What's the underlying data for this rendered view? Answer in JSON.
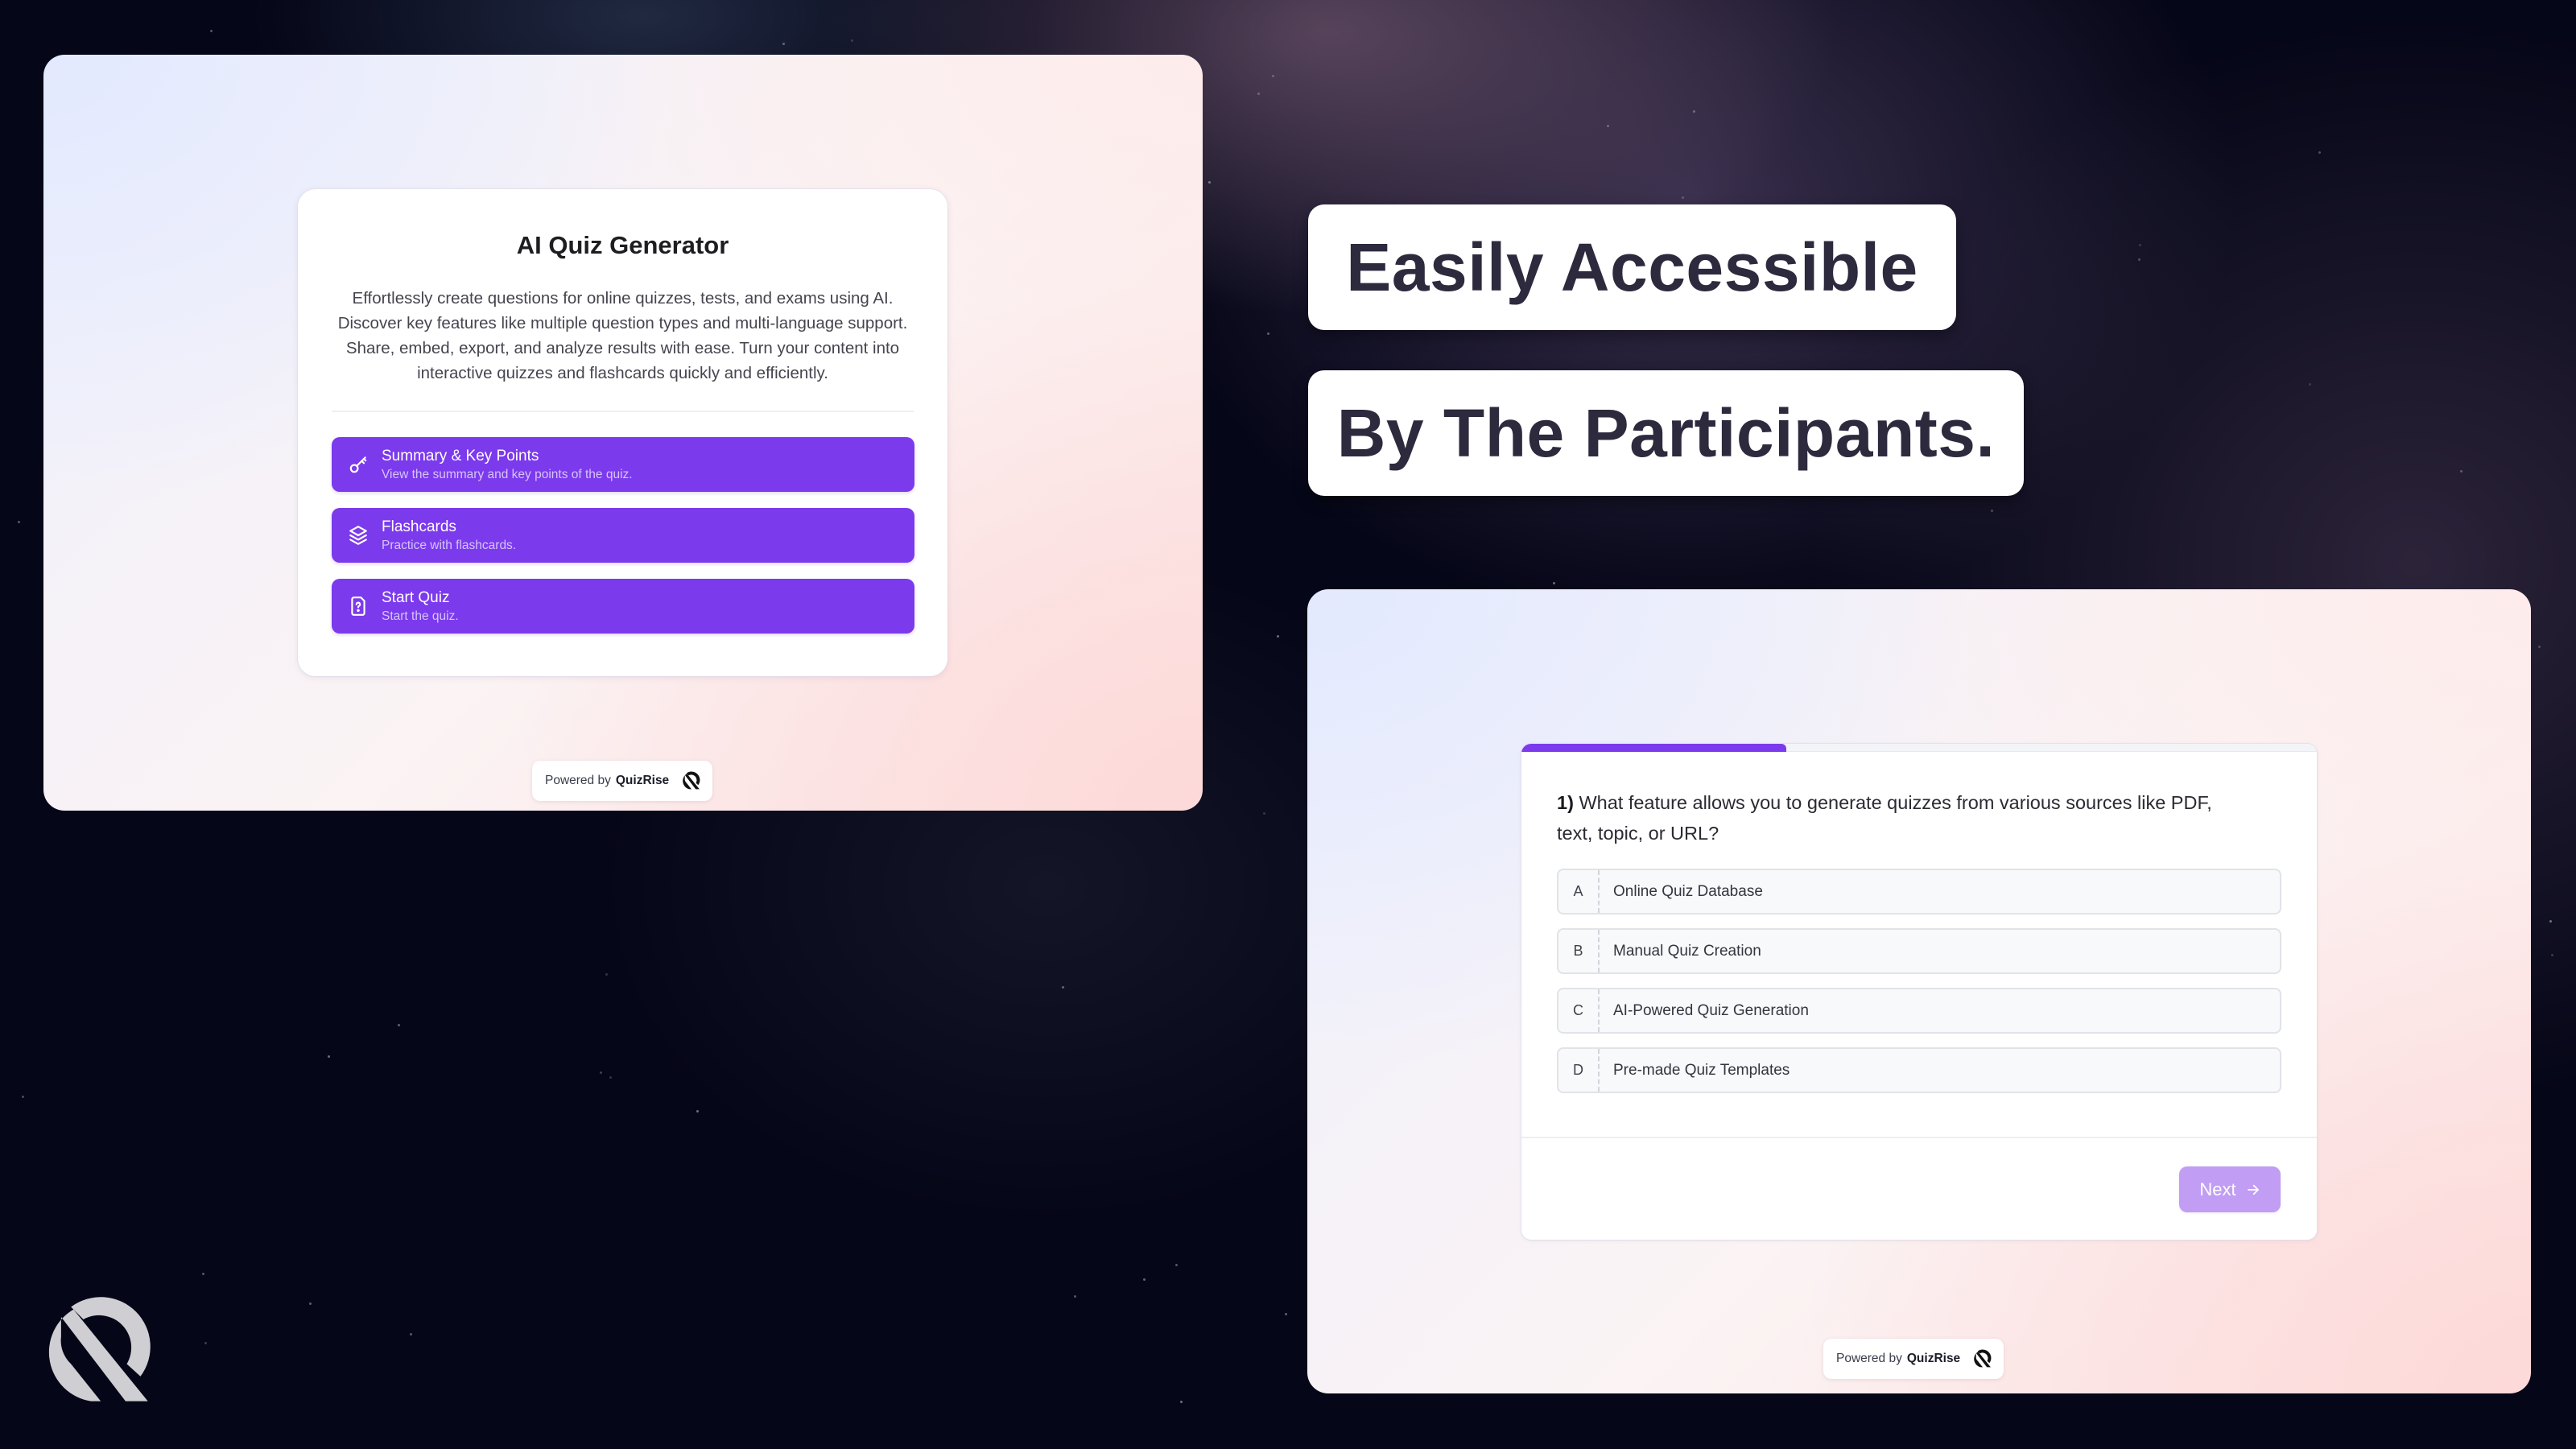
{
  "colors": {
    "accent": "#7c3aed",
    "accent_disabled": "#c19df4",
    "headline_text": "#2d2a3e",
    "background": "#050617",
    "logo_light": "#cfcfd3"
  },
  "generator_panel": {
    "title": "AI Quiz Generator",
    "description": "Effortlessly create questions for online quizzes, tests, and exams using AI. Discover key features like multiple question types and multi-language support. Share, embed, export, and analyze results with ease. Turn your content into interactive quizzes and flashcards quickly and efficiently.",
    "actions": [
      {
        "label": "Summary & Key Points",
        "sublabel": "View the summary and key points of the quiz.",
        "icon": "key-icon"
      },
      {
        "label": "Flashcards",
        "sublabel": "Practice with flashcards.",
        "icon": "layers-icon"
      },
      {
        "label": "Start Quiz",
        "sublabel": "Start the quiz.",
        "icon": "file-question-icon"
      }
    ],
    "powered_by": {
      "prefix": "Powered by",
      "brand": "QuizRise"
    }
  },
  "headlines": [
    "Easily Accessible",
    "By The Participants."
  ],
  "quiz_panel": {
    "progress_fraction": 0.333,
    "question_number": "1)",
    "question_text": "What feature allows you to generate quizzes from various sources like PDF, text, topic, or URL?",
    "options": [
      {
        "letter": "A",
        "text": "Online Quiz Database"
      },
      {
        "letter": "B",
        "text": "Manual Quiz Creation"
      },
      {
        "letter": "C",
        "text": "AI-Powered Quiz Generation"
      },
      {
        "letter": "D",
        "text": "Pre-made Quiz Templates"
      }
    ],
    "next_label": "Next",
    "next_icon": "arrow-right-icon",
    "powered_by": {
      "prefix": "Powered by",
      "brand": "QuizRise"
    }
  },
  "brand_logo": "quizrise-logo-icon"
}
